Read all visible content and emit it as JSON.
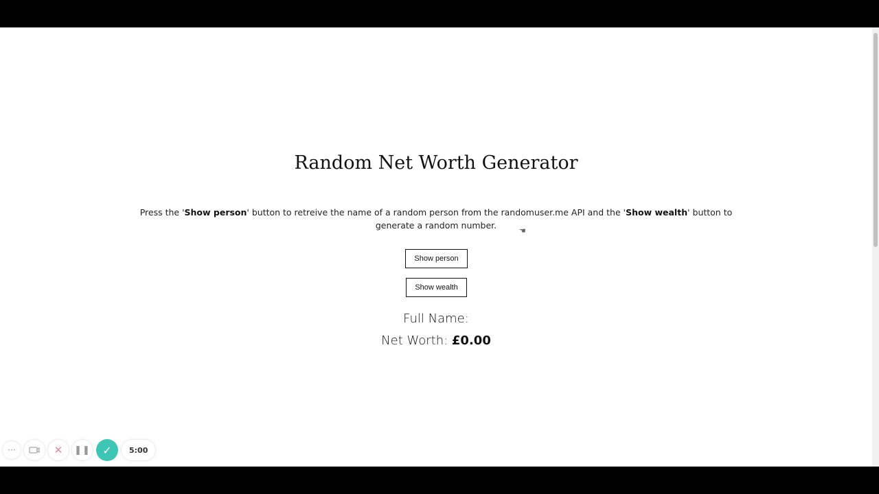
{
  "page": {
    "title": "Random Net Worth Generator",
    "description": {
      "part1": "Press the '",
      "show_person_ref": "Show person",
      "part2": "' button to retreive the name of a random person from the randomuser.me API and the '",
      "show_wealth_ref": "Show wealth",
      "part3": "' button to generate a random number."
    },
    "buttons": {
      "show_person": "Show person",
      "show_wealth": "Show wealth"
    },
    "results": {
      "full_name_label": "Full Name:",
      "full_name_value": "",
      "net_worth_label": "Net Worth:",
      "net_worth_value": "£0.00"
    }
  },
  "recorder": {
    "more_icon": "more-horizontal-icon",
    "camera_icon": "camera-toggle-icon",
    "close_icon": "close-icon",
    "pause_icon": "pause-icon",
    "done_icon": "check-icon",
    "timer": "5:00",
    "accent_color": "#3ec6b5"
  }
}
